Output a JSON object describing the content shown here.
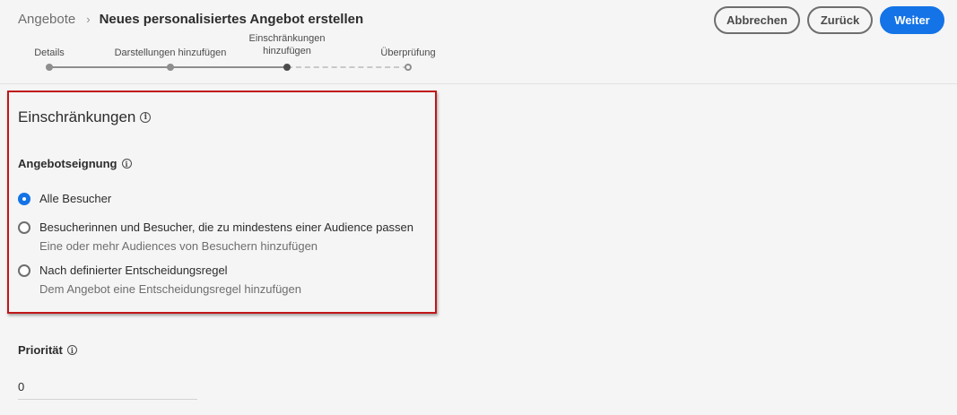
{
  "breadcrumb": {
    "root": "Angebote",
    "separator": "›",
    "title": "Neues personalisiertes Angebot erstellen"
  },
  "actions": {
    "cancel": "Abbrechen",
    "back": "Zurück",
    "next": "Weiter"
  },
  "stepper": {
    "steps": [
      {
        "label": "Details",
        "state": "done"
      },
      {
        "label": "Darstellungen hinzufügen",
        "state": "done"
      },
      {
        "label": "Einschränkungen\nhinzufügen",
        "state": "current"
      },
      {
        "label": "Überprüfung",
        "state": "todo"
      }
    ]
  },
  "constraints": {
    "title": "Einschränkungen",
    "eligibility_title": "Angebotseignung",
    "options": [
      {
        "label": "Alle Besucher",
        "description": "",
        "checked": true
      },
      {
        "label": "Besucherinnen und Besucher, die zu mindestens einer Audience passen",
        "description": "Eine oder mehr Audiences von Besuchern hinzufügen",
        "checked": false
      },
      {
        "label": "Nach definierter Entscheidungsregel",
        "description": "Dem Angebot eine Entscheidungsregel hinzufügen",
        "checked": false
      }
    ]
  },
  "priority": {
    "label": "Priorität",
    "value": "0"
  },
  "icons": {
    "info": "info-icon",
    "chevron": "chevron-right-icon"
  },
  "colors": {
    "primary": "#1473e6",
    "highlight_border": "#c0171b",
    "background": "#f5f5f5"
  }
}
